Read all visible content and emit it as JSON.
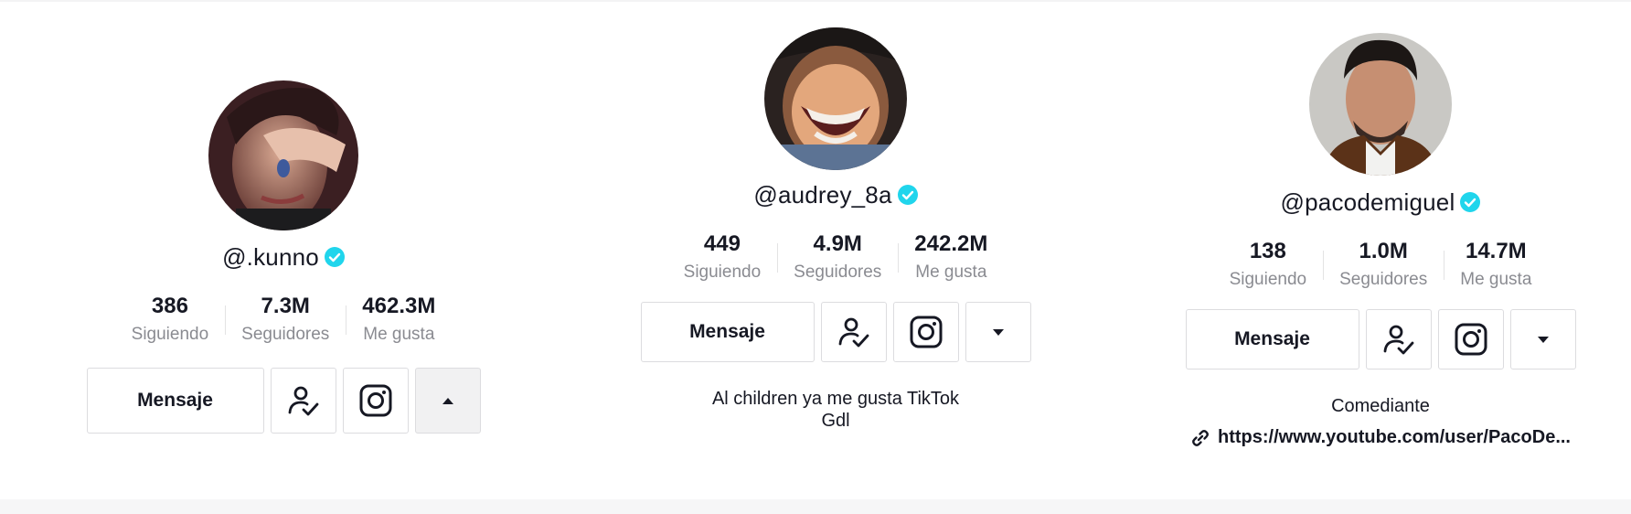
{
  "profiles": [
    {
      "handle": "@.kunno",
      "verified": true,
      "stats": [
        {
          "value": "386",
          "label": "Siguiendo"
        },
        {
          "value": "7.3M",
          "label": "Seguidores"
        },
        {
          "value": "462.3M",
          "label": "Me gusta"
        }
      ],
      "actions": {
        "message_label": "Mensaje",
        "following_icon": "user-check-icon",
        "instagram_icon": "instagram-icon",
        "toggle_icon": "caret-up-icon"
      }
    },
    {
      "handle": "@audrey_8a",
      "verified": true,
      "stats": [
        {
          "value": "449",
          "label": "Siguiendo"
        },
        {
          "value": "4.9M",
          "label": "Seguidores"
        },
        {
          "value": "242.2M",
          "label": "Me gusta"
        }
      ],
      "actions": {
        "message_label": "Mensaje",
        "following_icon": "user-check-icon",
        "instagram_icon": "instagram-icon",
        "toggle_icon": "caret-down-icon"
      },
      "bio": [
        "Al children ya me gusta TikTok",
        "Gdl"
      ]
    },
    {
      "handle": "@pacodemiguel",
      "verified": true,
      "stats": [
        {
          "value": "138",
          "label": "Siguiendo"
        },
        {
          "value": "1.0M",
          "label": "Seguidores"
        },
        {
          "value": "14.7M",
          "label": "Me gusta"
        }
      ],
      "actions": {
        "message_label": "Mensaje",
        "following_icon": "user-check-icon",
        "instagram_icon": "instagram-icon",
        "toggle_icon": "caret-down-icon"
      },
      "bio": [
        "Comediante"
      ],
      "link": "https://www.youtube.com/user/PacoDe..."
    }
  ],
  "colors": {
    "verified": "#20d5ec",
    "text": "#161823",
    "muted": "#8a8b91",
    "border": "#dcdcdf"
  }
}
